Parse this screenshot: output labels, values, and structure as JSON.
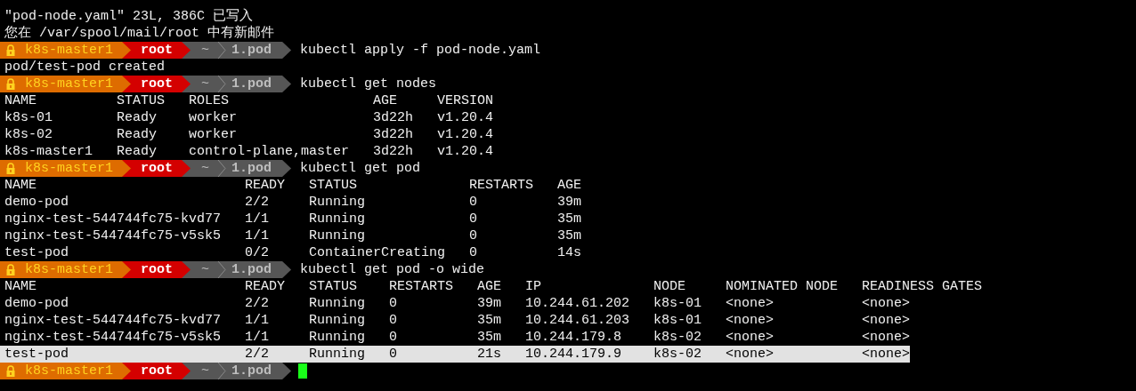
{
  "lines": [
    {
      "kind": "text",
      "text": "\"pod-node.yaml\" 23L, 386C 已写入"
    },
    {
      "kind": "text",
      "text": "您在 /var/spool/mail/root 中有新邮件"
    },
    {
      "kind": "prompt",
      "host": "k8s-master1",
      "user": "root",
      "dir": "~",
      "branch": "1.pod",
      "command": "kubectl apply -f pod-node.yaml"
    },
    {
      "kind": "text",
      "text": "pod/test-pod created"
    },
    {
      "kind": "prompt",
      "host": "k8s-master1",
      "user": "root",
      "dir": "~",
      "branch": "1.pod",
      "command": "kubectl get nodes"
    },
    {
      "kind": "table",
      "columns": [
        "NAME",
        "STATUS",
        "ROLES",
        "AGE",
        "VERSION"
      ],
      "rows": [
        {
          "cells": [
            "k8s-01",
            "Ready",
            "worker",
            "3d22h",
            "v1.20.4"
          ],
          "selected": false
        },
        {
          "cells": [
            "k8s-02",
            "Ready",
            "worker",
            "3d22h",
            "v1.20.4"
          ],
          "selected": false
        },
        {
          "cells": [
            "k8s-master1",
            "Ready",
            "control-plane,master",
            "3d22h",
            "v1.20.4"
          ],
          "selected": false
        }
      ]
    },
    {
      "kind": "prompt",
      "host": "k8s-master1",
      "user": "root",
      "dir": "~",
      "branch": "1.pod",
      "command": "kubectl get pod"
    },
    {
      "kind": "table",
      "columns": [
        "NAME",
        "READY",
        "STATUS",
        "RESTARTS",
        "AGE"
      ],
      "rows": [
        {
          "cells": [
            "demo-pod",
            "2/2",
            "Running",
            "0",
            "39m"
          ],
          "selected": false
        },
        {
          "cells": [
            "nginx-test-544744fc75-kvd77",
            "1/1",
            "Running",
            "0",
            "35m"
          ],
          "selected": false
        },
        {
          "cells": [
            "nginx-test-544744fc75-v5sk5",
            "1/1",
            "Running",
            "0",
            "35m"
          ],
          "selected": false
        },
        {
          "cells": [
            "test-pod",
            "0/2",
            "ContainerCreating",
            "0",
            "14s"
          ],
          "selected": false
        }
      ]
    },
    {
      "kind": "prompt",
      "host": "k8s-master1",
      "user": "root",
      "dir": "~",
      "branch": "1.pod",
      "command": "kubectl get pod -o wide"
    },
    {
      "kind": "table",
      "columns": [
        "NAME",
        "READY",
        "STATUS",
        "RESTARTS",
        "AGE",
        "IP",
        "NODE",
        "NOMINATED NODE",
        "READINESS GATES"
      ],
      "rows": [
        {
          "cells": [
            "demo-pod",
            "2/2",
            "Running",
            "0",
            "39m",
            "10.244.61.202",
            "k8s-01",
            "<none>",
            "<none>"
          ],
          "selected": false
        },
        {
          "cells": [
            "nginx-test-544744fc75-kvd77",
            "1/1",
            "Running",
            "0",
            "35m",
            "10.244.61.203",
            "k8s-01",
            "<none>",
            "<none>"
          ],
          "selected": false
        },
        {
          "cells": [
            "nginx-test-544744fc75-v5sk5",
            "1/1",
            "Running",
            "0",
            "35m",
            "10.244.179.8",
            "k8s-02",
            "<none>",
            "<none>"
          ],
          "selected": false
        },
        {
          "cells": [
            "test-pod",
            "2/2",
            "Running",
            "0",
            "21s",
            "10.244.179.9",
            "k8s-02",
            "<none>",
            "<none>"
          ],
          "selected": true
        }
      ]
    },
    {
      "kind": "prompt",
      "host": "k8s-master1",
      "user": "root",
      "dir": "~",
      "branch": "1.pod",
      "cursor": true
    }
  ]
}
